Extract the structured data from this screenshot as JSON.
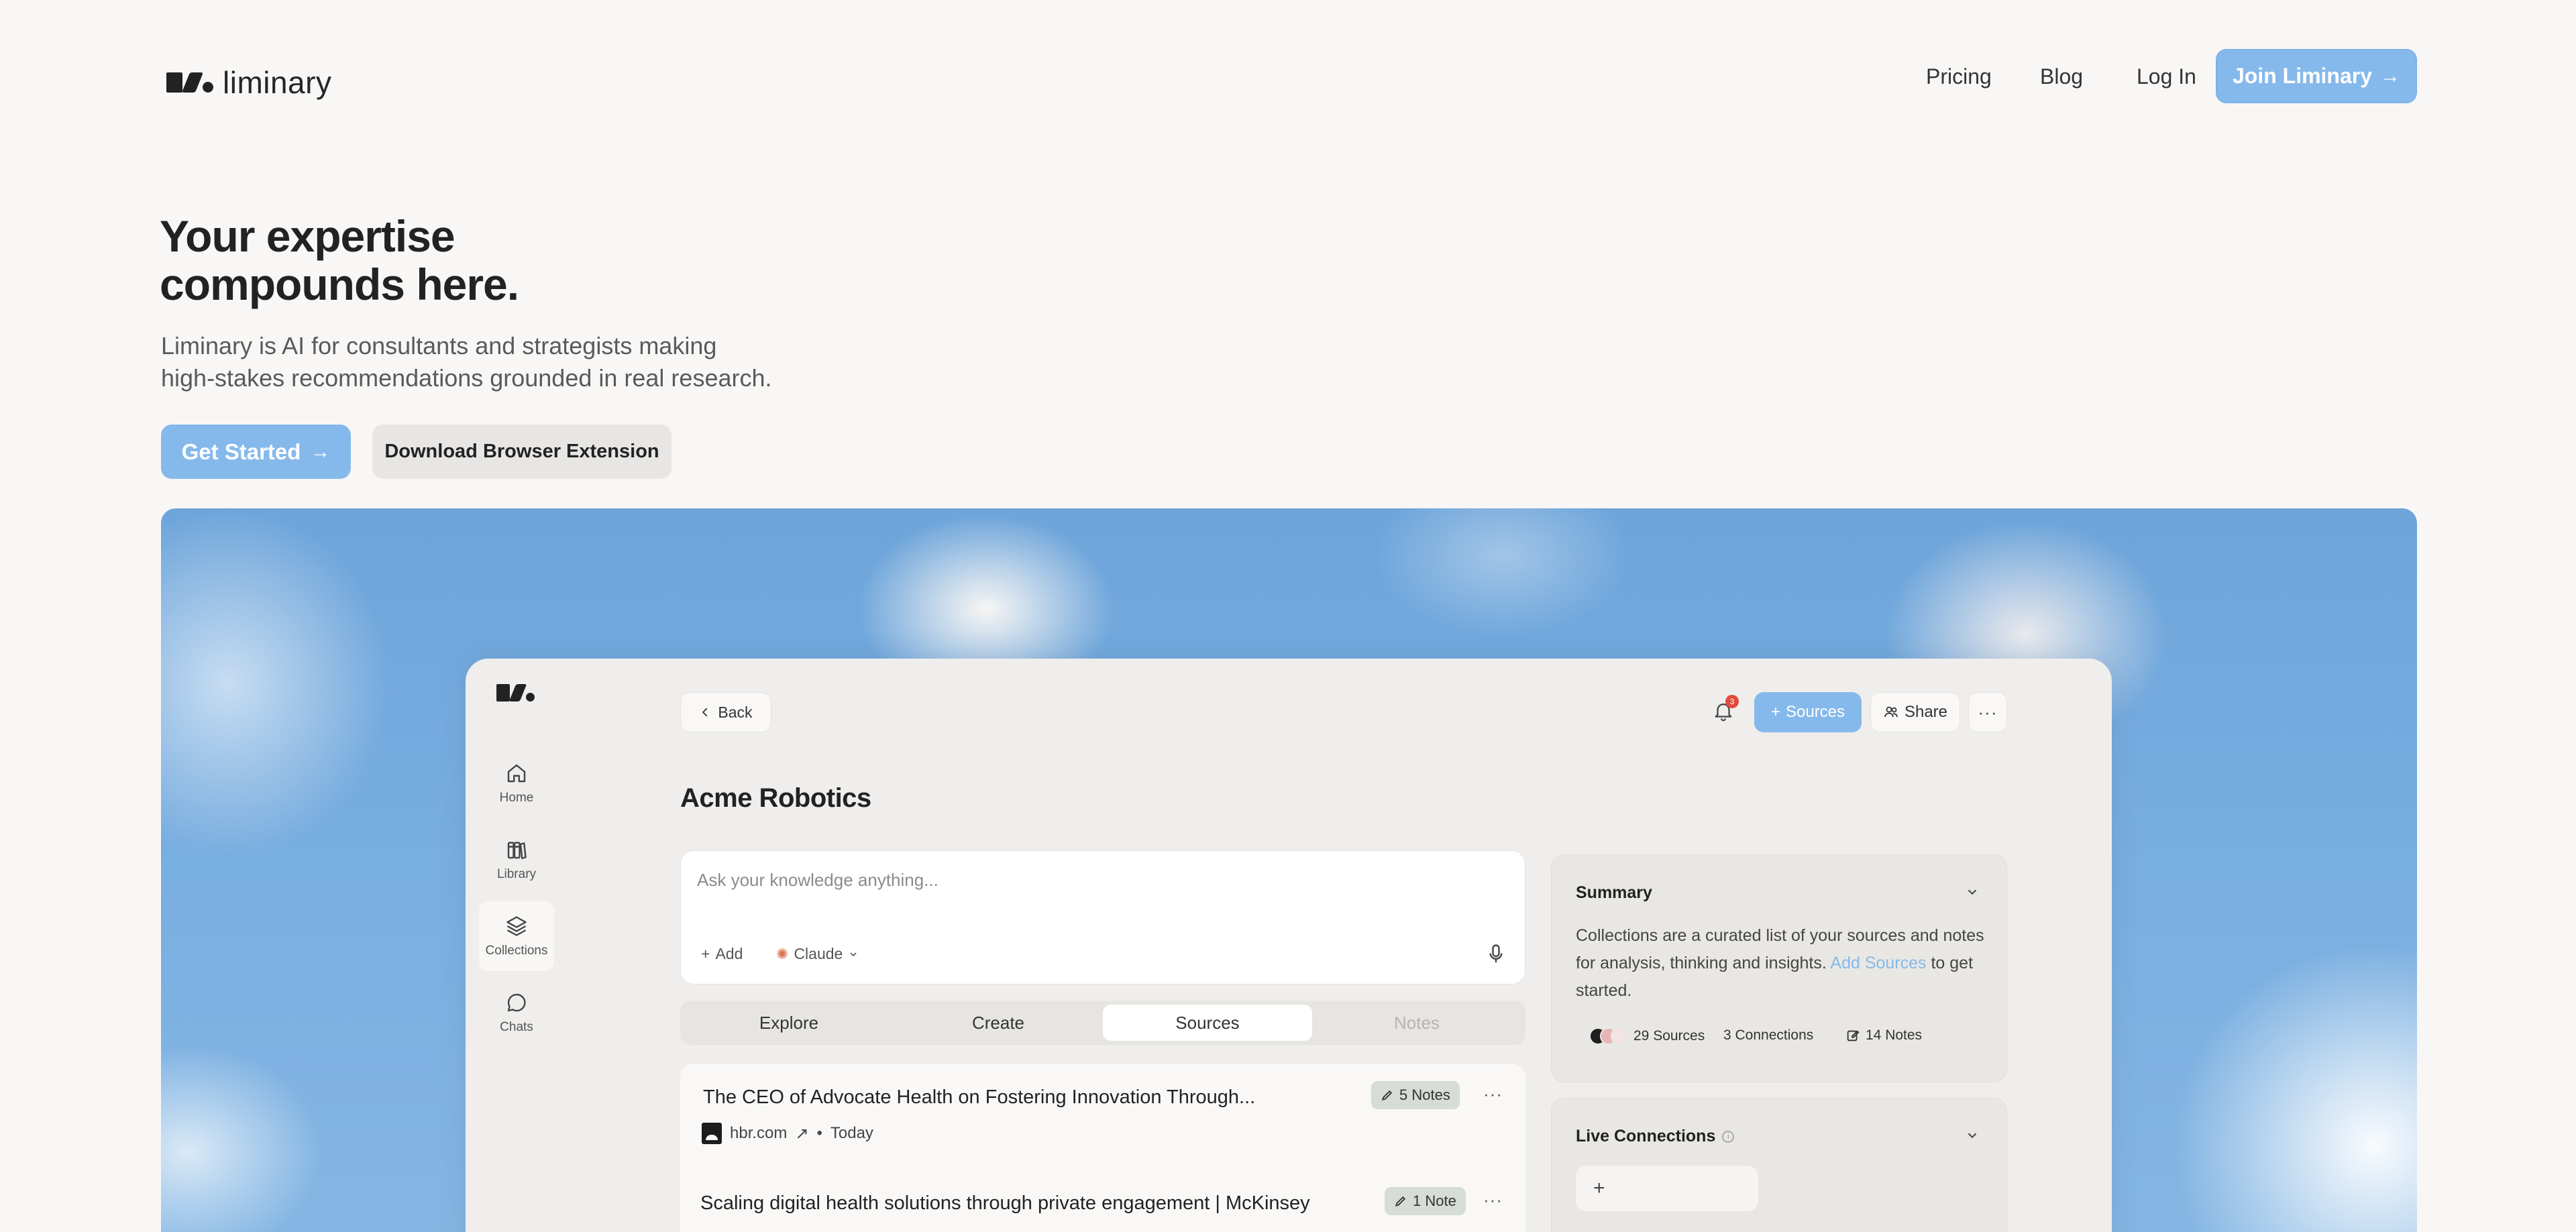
{
  "brand": {
    "name": "liminary"
  },
  "nav": {
    "links": [
      "Pricing",
      "Blog",
      "Log In"
    ],
    "cta": "Join Liminary"
  },
  "hero": {
    "headline_line1": "Your expertise",
    "headline_line2": "compounds here.",
    "sub_line1": "Liminary is AI for consultants and strategists making",
    "sub_line2": "high-stakes recommendations grounded in real research.",
    "primary_cta": "Get Started",
    "secondary_cta": "Download Browser Extension"
  },
  "app": {
    "sidebar": [
      {
        "label": "Home",
        "icon": "home-icon"
      },
      {
        "label": "Library",
        "icon": "library-icon"
      },
      {
        "label": "Collections",
        "icon": "layers-icon",
        "active": true
      },
      {
        "label": "Chats",
        "icon": "chat-bubble-icon"
      }
    ],
    "back_label": "Back",
    "notification_count": "3",
    "sources_label": "Sources",
    "share_label": "Share",
    "title": "Acme Robotics",
    "ask": {
      "placeholder": "Ask your knowledge anything...",
      "add_label": "Add",
      "model_label": "Claude"
    },
    "tabs": [
      "Explore",
      "Create",
      "Sources",
      "Notes"
    ],
    "active_tab": "Sources",
    "sources": [
      {
        "title": "The CEO of Advocate Health on Fostering Innovation Through...",
        "notes": "5 Notes",
        "domain": "hbr.com",
        "date": "Today"
      },
      {
        "title": "Scaling digital health solutions through private engagement | McKinsey",
        "notes": "1 Note"
      }
    ],
    "summary": {
      "heading": "Summary",
      "text_before": "Collections are a curated list of your sources and notes for analysis, thinking and insights. ",
      "link": "Add Sources",
      "text_after": " to get started.",
      "stats": [
        "29 Sources",
        "3 Connections",
        "14 Notes"
      ]
    },
    "live_connections": {
      "heading": "Live Connections",
      "add_symbol": "+"
    }
  },
  "colors": {
    "accent": "#86b9eb",
    "background": "#f8f7f6",
    "sky": "#79aee0"
  }
}
